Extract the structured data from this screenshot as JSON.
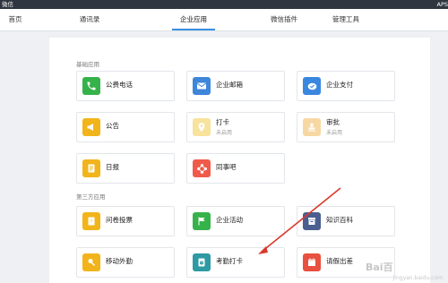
{
  "window": {
    "title": "微信",
    "corner": "APS"
  },
  "nav": {
    "tabs": [
      "首页",
      "通讯录",
      "企业应用",
      "微信插件",
      "管理工具"
    ]
  },
  "sections": {
    "basic": "基础应用",
    "third": "第三方应用"
  },
  "apps": {
    "phone": {
      "name": "公费电话",
      "color": "#36b24a",
      "icon": "phone-icon"
    },
    "mail": {
      "name": "企业邮箱",
      "color": "#3d86d9",
      "icon": "mail-icon"
    },
    "pay": {
      "name": "企业支付",
      "color": "#3a87e0",
      "icon": "payment-icon"
    },
    "notice": {
      "name": "公告",
      "color": "#f2b41b",
      "icon": "megaphone-icon"
    },
    "checkin": {
      "name": "打卡",
      "status": "未启用",
      "color": "#f7e39c",
      "icon": "location-pin-icon"
    },
    "approval": {
      "name": "审批",
      "status": "未启用",
      "color": "#f7d8a3",
      "icon": "approval-icon"
    },
    "daily": {
      "name": "日报",
      "color": "#f2b41b",
      "icon": "report-icon"
    },
    "bar": {
      "name": "同事吧",
      "color": "#f05a4a",
      "icon": "colleague-forum-icon"
    },
    "survey": {
      "name": "问卷投票",
      "color": "#f2b41b",
      "icon": "survey-icon"
    },
    "activity": {
      "name": "企业活动",
      "color": "#36b24a",
      "icon": "flag-icon"
    },
    "wiki": {
      "name": "知识百科",
      "color": "#4a5e8f",
      "icon": "archive-icon"
    },
    "field": {
      "name": "移动外勤",
      "color": "#f2b41b",
      "icon": "field-work-icon"
    },
    "attendance": {
      "name": "考勤打卡",
      "color": "#2e9aa3",
      "icon": "clock-icon"
    },
    "leave": {
      "name": "请假出差",
      "color": "#e8503f",
      "icon": "calendar-icon"
    }
  },
  "watermark": {
    "logo": "Bai百",
    "site": "jingyan.baidu.com"
  }
}
